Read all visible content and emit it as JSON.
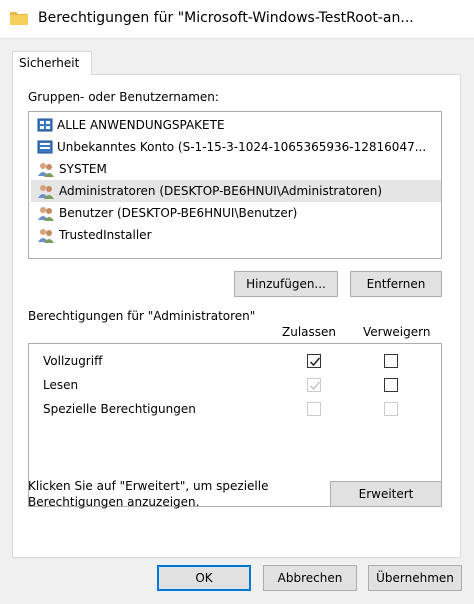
{
  "window": {
    "title": "Berechtigungen für \"Microsoft-Windows-TestRoot-an..."
  },
  "tabs": [
    {
      "label": "Sicherheit",
      "active": true
    }
  ],
  "groups": {
    "label": "Gruppen- oder Benutzernamen:",
    "items": [
      {
        "label": "ALLE ANWENDUNGSPAKETE",
        "icon": "app-package-icon",
        "selected": false
      },
      {
        "label": "Unbekanntes Konto (S-1-15-3-1024-1065365936-12816047...",
        "icon": "unknown-account-icon",
        "selected": false
      },
      {
        "label": "SYSTEM",
        "icon": "group-icon",
        "selected": false
      },
      {
        "label": "Administratoren (DESKTOP-BE6HNUI\\Administratoren)",
        "icon": "group-icon",
        "selected": true
      },
      {
        "label": "Benutzer (DESKTOP-BE6HNUI\\Benutzer)",
        "icon": "group-icon",
        "selected": false
      },
      {
        "label": "TrustedInstaller",
        "icon": "group-icon",
        "selected": false
      }
    ],
    "add_button": "Hinzufügen...",
    "remove_button": "Entfernen"
  },
  "permissions": {
    "label": "Berechtigungen für \"Administratoren\"",
    "allow_header": "Zulassen",
    "deny_header": "Verweigern",
    "rows": [
      {
        "name": "Vollzugriff",
        "allow": true,
        "allow_enabled": true,
        "deny": false,
        "deny_enabled": true
      },
      {
        "name": "Lesen",
        "allow": true,
        "allow_enabled": false,
        "deny": false,
        "deny_enabled": true
      },
      {
        "name": "Spezielle Berechtigungen",
        "allow": false,
        "allow_enabled": false,
        "deny": false,
        "deny_enabled": false
      }
    ]
  },
  "advanced": {
    "hint_line1": "Klicken Sie auf \"Erweitert\", um spezielle",
    "hint_line2": "Berechtigungen anzuzeigen.",
    "button": "Erweitert"
  },
  "footer": {
    "ok": "OK",
    "cancel": "Abbrechen",
    "apply": "Übernehmen"
  },
  "colors": {
    "accent": "#0078d7",
    "face": "#f0f0f0",
    "selection": "#e5e5e5"
  }
}
